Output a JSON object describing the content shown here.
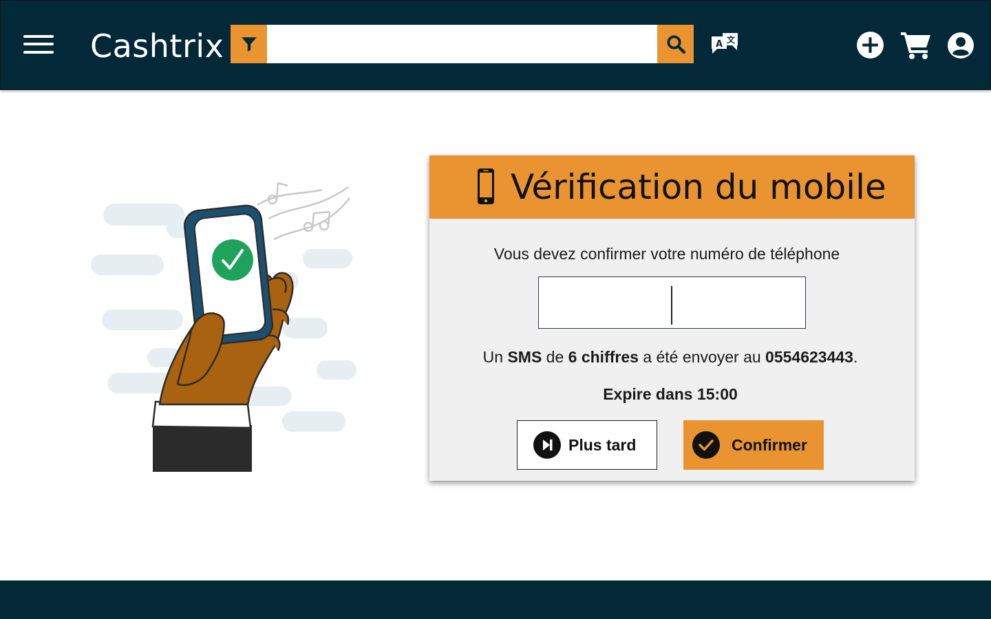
{
  "header": {
    "app_name": "Cashtrix",
    "search": {
      "value": "",
      "placeholder": ""
    },
    "icons": {
      "menu": "hamburger-menu-icon",
      "filter": "filter-funnel-icon",
      "search": "magnifier-icon",
      "translate": "translate-icon",
      "add": "plus-circle-icon",
      "cart": "shopping-cart-icon",
      "account": "user-circle-icon"
    }
  },
  "verification": {
    "title": "Vérification du mobile",
    "instruction": "Vous devez confirmer votre numéro de téléphone",
    "code_value": "",
    "sms_parts": {
      "p1": "Un ",
      "b1": "SMS",
      "p2": " de ",
      "b2": "6 chiffres",
      "p3": " a été envoyer au ",
      "phone": "0554623443",
      "p4": "."
    },
    "expire_text": "Expire dans 15:00",
    "later_label": "Plus tard",
    "confirm_label": "Confirmer"
  },
  "colors": {
    "navy": "#032838",
    "accent_orange": "#e99431",
    "card_bg": "#f0f0f0",
    "success_green": "#1fa25c"
  }
}
